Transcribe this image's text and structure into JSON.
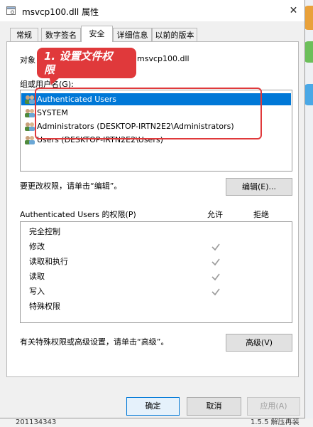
{
  "window": {
    "title": "msvcp100.dll 属性",
    "close_glyph": "✕"
  },
  "tabs": [
    {
      "label": "常规"
    },
    {
      "label": "数字签名"
    },
    {
      "label": "安全"
    },
    {
      "label": "详细信息"
    },
    {
      "label": "以前的版本"
    }
  ],
  "active_tab": "安全",
  "security": {
    "object_label": "对象",
    "object_value": "msvcp100.dll",
    "groups_label": "组或用户名(G):",
    "users": [
      {
        "name": "Authenticated Users",
        "selected": true
      },
      {
        "name": "SYSTEM",
        "selected": false
      },
      {
        "name": "Administrators (DESKTOP-IRTN2E2\\Administrators)",
        "selected": false
      },
      {
        "name": "Users (DESKTOP-IRTN2E2\\Users)",
        "selected": false
      }
    ],
    "change_hint": "要更改权限，请单击“编辑”。",
    "edit_button": "编辑(E)...",
    "permissions_title": "Authenticated Users 的权限(P)",
    "allow_header": "允许",
    "deny_header": "拒绝",
    "permissions": [
      {
        "name": "完全控制",
        "allow": false
      },
      {
        "name": "修改",
        "allow": true
      },
      {
        "name": "读取和执行",
        "allow": true
      },
      {
        "name": "读取",
        "allow": true
      },
      {
        "name": "写入",
        "allow": true
      },
      {
        "name": "特殊权限",
        "allow": false
      }
    ],
    "advanced_hint": "有关特殊权限或高级设置，请单击“高级”。",
    "advanced_button": "高级(V)"
  },
  "footer": {
    "ok": "确定",
    "cancel": "取消",
    "apply": "应用(A)"
  },
  "annotation": {
    "line1": "1. 设置文件权",
    "line2": "限"
  },
  "background": {
    "left_text": "201134343",
    "right_text": "1.5.5 解压再装"
  },
  "colors": {
    "selection": "#0078d7",
    "annotation": "#e0393b",
    "check": "#9a9a9a"
  }
}
